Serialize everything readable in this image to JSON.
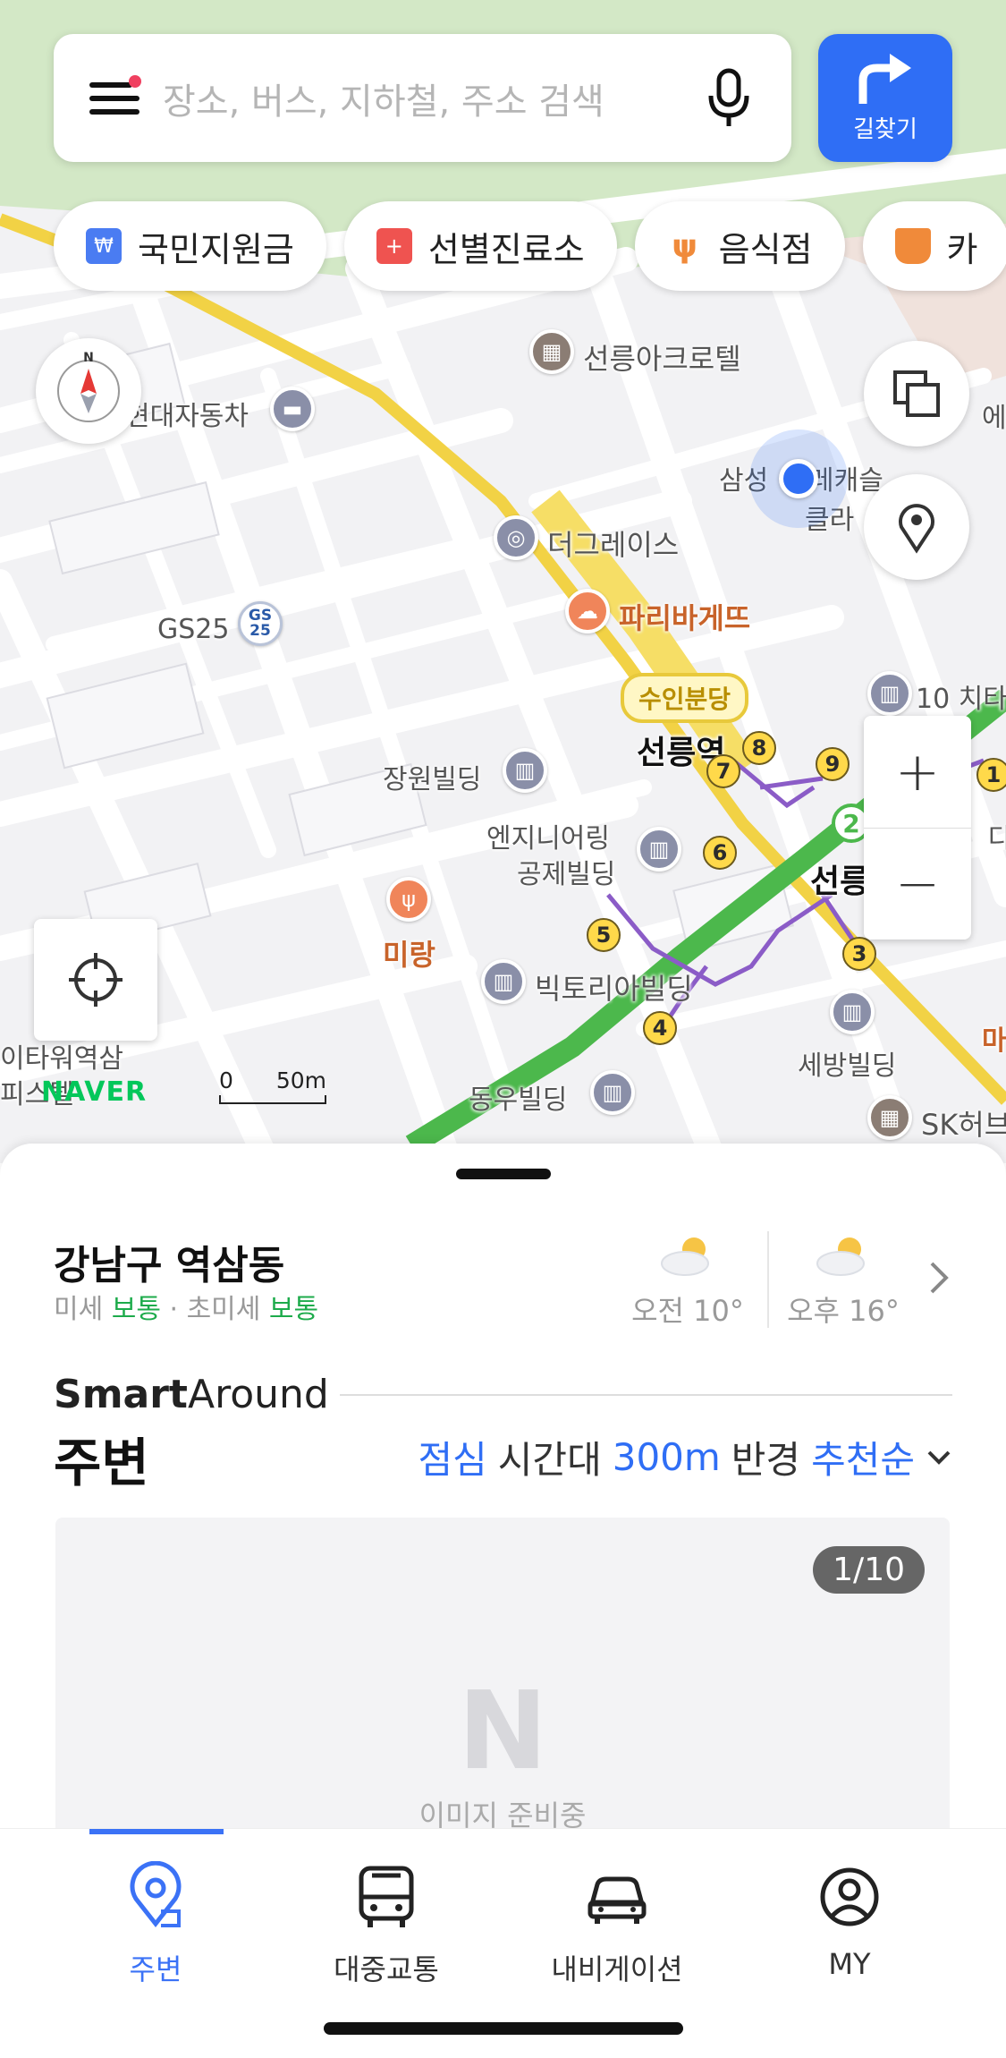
{
  "search": {
    "placeholder": "장소, 버스, 지하철, 주소 검색",
    "route_label": "길찾기"
  },
  "chips": [
    {
      "label": "국민지원금",
      "icon": "won-card-icon",
      "color": "#4a7cf2"
    },
    {
      "label": "선별진료소",
      "icon": "medical-cross-icon",
      "color": "#ef5350"
    },
    {
      "label": "음식점",
      "icon": "fork-knife-icon",
      "color": "#f08a3a"
    },
    {
      "label": "카",
      "icon": "coffee-cup-icon",
      "color": "#f08a3a"
    }
  ],
  "map": {
    "places": [
      {
        "name": "선릉아크로텔"
      },
      {
        "name": "현대자동차"
      },
      {
        "name": "삼성"
      },
      {
        "name": "레캐슬"
      },
      {
        "name": "클라"
      },
      {
        "name": "더그레이스"
      },
      {
        "name": "파리바게뜨"
      },
      {
        "name": "GS25"
      },
      {
        "name": "10 치타"
      },
      {
        "name": "선릉역"
      },
      {
        "name": "장원빌딩"
      },
      {
        "name": "엔지니어링"
      },
      {
        "name": "공제빌딩"
      },
      {
        "name": "선릉"
      },
      {
        "name": "미랑"
      },
      {
        "name": "빅토리아빌딩"
      },
      {
        "name": "세방빌딩"
      },
      {
        "name": "동우빌딩"
      },
      {
        "name": "SK허브"
      },
      {
        "name": "이타워역삼"
      },
      {
        "name": "피스텔"
      },
      {
        "name": "에"
      },
      {
        "name": "다"
      },
      {
        "name": "마"
      }
    ],
    "station_tag": "수인분당",
    "exits": [
      "4",
      "5",
      "6",
      "7",
      "8",
      "9",
      "1",
      "3"
    ],
    "scale": {
      "start": "0",
      "end": "50m"
    },
    "logo": "NAVER",
    "line2_badge": "2",
    "colors": {
      "line2": "#4cb84c",
      "suin_bundang": "#f2d245",
      "exit_line": "#8b5cc7",
      "location": "#2f6ef5"
    }
  },
  "sheet": {
    "location": "강남구 역삼동",
    "air": {
      "fine_label": "미세",
      "fine_value": "보통",
      "sep": " · ",
      "ultra_label": "초미세",
      "ultra_value": "보통"
    },
    "weather": [
      {
        "text": "오전 10°",
        "icon": "partly-cloudy-icon"
      },
      {
        "text": "오후 16°",
        "icon": "partly-cloudy-icon"
      }
    ],
    "smart_bold": "Smart",
    "smart_rest": "Around",
    "nearby_title": "주변",
    "filter": {
      "time": "점심",
      "time_suffix": "시간대",
      "radius": "300m",
      "radius_suffix": "반경",
      "sort": "추천순"
    },
    "card": {
      "counter": "1/10",
      "placeholder": "이미지 준비중",
      "logo_letter": "N"
    }
  },
  "tabs": [
    {
      "label": "주변",
      "icon": "location-pin-icon",
      "active": true
    },
    {
      "label": "대중교통",
      "icon": "bus-icon",
      "active": false
    },
    {
      "label": "내비게이션",
      "icon": "car-icon",
      "active": false
    },
    {
      "label": "MY",
      "icon": "user-circle-icon",
      "active": false
    }
  ]
}
